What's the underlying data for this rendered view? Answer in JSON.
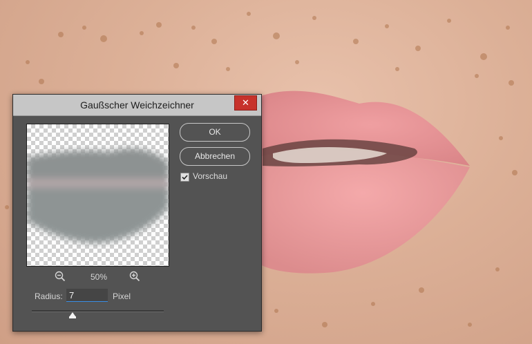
{
  "dialog": {
    "title": "Gaußscher Weichzeichner",
    "close_glyph": "✕",
    "ok_label": "OK",
    "cancel_label": "Abbrechen",
    "preview_checkbox_label": "Vorschau",
    "preview_checked": true,
    "zoom_value": "50%",
    "radius_label": "Radius:",
    "radius_value": "7",
    "radius_unit": "Pixel",
    "radius_slider_fraction": 0.31
  },
  "icons": {
    "close": "close-icon",
    "zoom_out": "zoom-out-icon",
    "zoom_in": "zoom-in-icon",
    "check": "checkmark-icon"
  },
  "colors": {
    "dialog_bg": "#535353",
    "titlebar_bg": "#c6c6c6",
    "close_bg": "#c7322b",
    "input_underline": "#3a8ee6"
  }
}
